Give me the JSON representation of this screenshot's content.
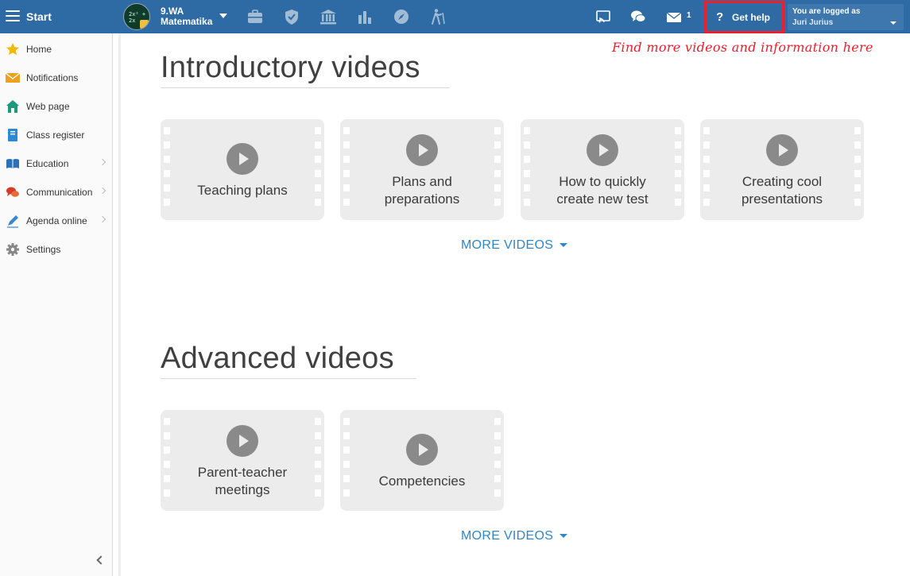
{
  "topbar": {
    "start_label": "Start",
    "class_code": "9.WA",
    "class_subject": "Matematika",
    "class_avatar_chalk": "2x² + 2x",
    "message_count": "1",
    "help_label": "Get help",
    "help_mark": "?",
    "logged_as_label": "You are logged as",
    "user_name": "Juri Jurius",
    "accent": "#2e6aa3",
    "help_border_color": "#e8212e"
  },
  "sidebar": {
    "items": [
      {
        "label": "Home",
        "icon": "star-icon",
        "submenu": false
      },
      {
        "label": "Notifications",
        "icon": "envelope-icon",
        "submenu": false
      },
      {
        "label": "Web page",
        "icon": "house-icon",
        "submenu": false
      },
      {
        "label": "Class register",
        "icon": "notebook-icon",
        "submenu": false
      },
      {
        "label": "Education",
        "icon": "book-icon",
        "submenu": true
      },
      {
        "label": "Communication",
        "icon": "chat-icon",
        "submenu": true
      },
      {
        "label": "Agenda online",
        "icon": "pen-icon",
        "submenu": true
      },
      {
        "label": "Settings",
        "icon": "gear-icon",
        "submenu": false
      }
    ]
  },
  "main": {
    "annotation": "Find more videos and information here",
    "sections": [
      {
        "title": "Introductory videos",
        "videos": [
          {
            "title": "Teaching plans"
          },
          {
            "title": "Plans and preparations"
          },
          {
            "title": "How to quickly create new test"
          },
          {
            "title": "Creating cool presentations"
          }
        ],
        "more_label": "MORE VIDEOS"
      },
      {
        "title": "Advanced videos",
        "videos": [
          {
            "title": "Parent-teacher meetings"
          },
          {
            "title": "Competencies"
          }
        ],
        "more_label": "MORE VIDEOS"
      }
    ]
  }
}
